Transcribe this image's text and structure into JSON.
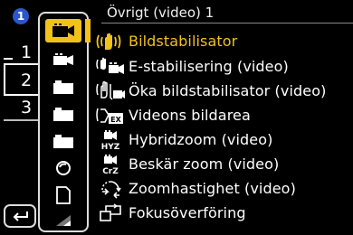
{
  "header": {
    "title": "Övrigt (video) 1"
  },
  "page_badge": "1",
  "side_numbers": [
    "1",
    "2",
    "3"
  ],
  "tabs": [
    {
      "icon": "video-camera-icon",
      "active": true
    },
    {
      "icon": "video-camera-icon",
      "active": false
    },
    {
      "icon": "camera-icon",
      "active": false
    },
    {
      "icon": "camera-icon",
      "active": false
    },
    {
      "icon": "camera-icon",
      "active": false
    },
    {
      "icon": "lens-icon",
      "active": false
    },
    {
      "icon": "card-icon",
      "active": false
    },
    {
      "icon": "wireless-icon",
      "active": false
    }
  ],
  "menu": [
    {
      "label": "Bildstabilisator",
      "icon": "hand-shake-icon",
      "selected": true
    },
    {
      "label": "E-stabilisering (video)",
      "icon": "electronic-stabilizer-icon",
      "selected": false
    },
    {
      "label": "Öka bildstabilisator (video)",
      "icon": "boost-stabilizer-icon",
      "selected": false
    },
    {
      "label": "Videons bildarea",
      "icon": "image-area-icon",
      "selected": false
    },
    {
      "label": "Hybridzoom (video)",
      "icon": "hybrid-zoom-icon",
      "selected": false
    },
    {
      "label": "Beskär zoom (video)",
      "icon": "crop-zoom-icon",
      "selected": false
    },
    {
      "label": "Zoomhastighet (video)",
      "icon": "zoom-speed-icon",
      "selected": false
    },
    {
      "label": "Fokusöverföring",
      "icon": "focus-transition-icon",
      "selected": false
    }
  ],
  "colors": {
    "accent": "#f1c219",
    "badge": "#2a57c9",
    "background": "#000000"
  }
}
